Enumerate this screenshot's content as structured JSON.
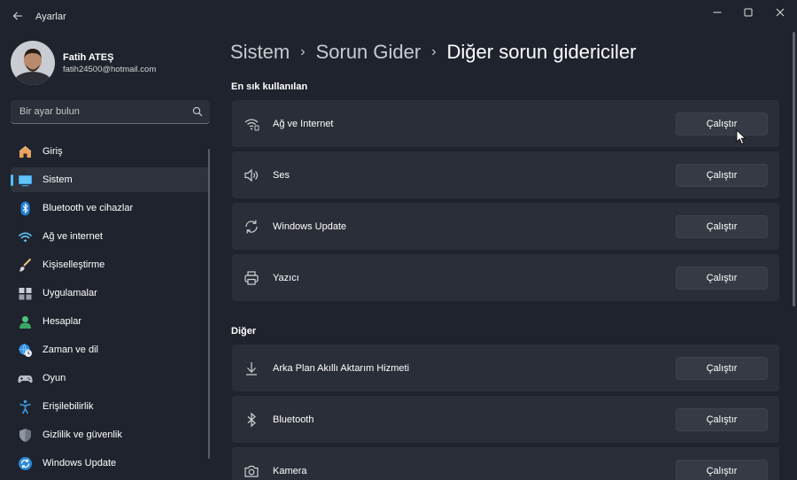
{
  "app": {
    "title": "Ayarlar"
  },
  "user": {
    "name": "Fatih ATEŞ",
    "email": "fatih24500@hotmail.com"
  },
  "search": {
    "placeholder": "Bir ayar bulun"
  },
  "sidebar": {
    "items": [
      {
        "label": "Giriş",
        "icon": "home-icon"
      },
      {
        "label": "Sistem",
        "icon": "system-icon",
        "active": true
      },
      {
        "label": "Bluetooth ve cihazlar",
        "icon": "bluetooth-icon"
      },
      {
        "label": "Ağ ve internet",
        "icon": "network-icon"
      },
      {
        "label": "Kişiselleştirme",
        "icon": "brush-icon"
      },
      {
        "label": "Uygulamalar",
        "icon": "apps-icon"
      },
      {
        "label": "Hesaplar",
        "icon": "account-icon"
      },
      {
        "label": "Zaman ve dil",
        "icon": "globe-clock-icon"
      },
      {
        "label": "Oyun",
        "icon": "gamepad-icon"
      },
      {
        "label": "Erişilebilirlik",
        "icon": "accessibility-icon"
      },
      {
        "label": "Gizlilik ve güvenlik",
        "icon": "shield-icon"
      },
      {
        "label": "Windows Update",
        "icon": "windows-update-icon"
      }
    ]
  },
  "breadcrumb": {
    "part1": "Sistem",
    "part2": "Sorun Gider",
    "current": "Diğer sorun gidericiler"
  },
  "sections": {
    "frequent": {
      "title": "En sık kullanılan",
      "items": [
        {
          "label": "Ağ ve Internet",
          "icon": "wifi-icon",
          "button": "Çalıştır"
        },
        {
          "label": "Ses",
          "icon": "speaker-icon",
          "button": "Çalıştır"
        },
        {
          "label": "Windows Update",
          "icon": "refresh-icon",
          "button": "Çalıştır"
        },
        {
          "label": "Yazıcı",
          "icon": "printer-icon",
          "button": "Çalıştır"
        }
      ]
    },
    "other": {
      "title": "Diğer",
      "items": [
        {
          "label": "Arka Plan Akıllı Aktarım Hizmeti",
          "icon": "download-icon",
          "button": "Çalıştır"
        },
        {
          "label": "Bluetooth",
          "icon": "bluetooth-icon",
          "button": "Çalıştır"
        },
        {
          "label": "Kamera",
          "icon": "camera-icon",
          "button": "Çalıştır"
        }
      ]
    }
  },
  "colors": {
    "accent": "#4cc2ff",
    "background": "#1f232d",
    "card": "#2a2e38"
  }
}
